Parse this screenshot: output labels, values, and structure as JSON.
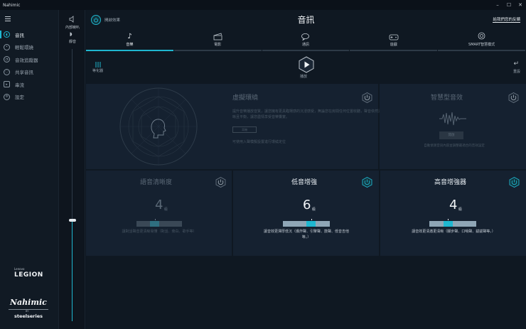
{
  "app": {
    "title": "Nahimic"
  },
  "window_controls": {
    "minimize": "–",
    "maximize": "☐",
    "close": "✕"
  },
  "sidebar": {
    "items": [
      {
        "label": "音訊",
        "icon": "audio-icon",
        "active": true
      },
      {
        "label": "輕鬆環繞",
        "icon": "surround-icon",
        "active": false
      },
      {
        "label": "音效追蹤器",
        "icon": "sound-tracker-icon",
        "active": false
      },
      {
        "label": "共享音訊",
        "icon": "share-audio-icon",
        "active": false
      },
      {
        "label": "串流",
        "icon": "stream-icon",
        "active": false
      },
      {
        "label": "設定",
        "icon": "gear-icon",
        "active": false
      }
    ],
    "brand_small": "Lenovo",
    "brand_legion": "LEGION",
    "brand_nahimic": "Nahimic",
    "brand_by": "BY",
    "brand_steelseries": "steelseries"
  },
  "volume": {
    "device_label": "內部喇叭",
    "mute_label": "靜音",
    "level": 0.37
  },
  "header": {
    "power_label": "開啟效果",
    "title": "音訊",
    "feedback": "給我們您的反饋"
  },
  "tabs": [
    {
      "label": "音樂",
      "icon": "music-icon",
      "active": true
    },
    {
      "label": "電影",
      "icon": "movie-icon",
      "active": false
    },
    {
      "label": "通訊",
      "icon": "chat-icon",
      "active": false
    },
    {
      "label": "遊戲",
      "icon": "gamepad-icon",
      "active": false
    },
    {
      "label": "SMART智慧模式",
      "icon": "smart-icon",
      "active": false
    }
  ],
  "toolbar": {
    "eq_label": "等化器",
    "play_label": "播放",
    "reset_label": "重設"
  },
  "virtual_surround": {
    "title": "虛擬環繞",
    "desc": "提升音樂播放音質，讓您擁有更具臨場感的沉浸感受，無論您在房間任何位置收聽，聲音依然清晰且平衡，讓您盡情享受音樂饗宴。",
    "tag": "耳機",
    "foot": "可使用入聲模擬設置進行環繞定位"
  },
  "smart_effect": {
    "title": "智慧型音效",
    "button": "開啟",
    "desc": "自動偵測音訊內容並調整最適合的音效設定"
  },
  "clarity": {
    "title": "語音清晰度",
    "level": 4,
    "unit": "級",
    "desc": "讓對話聲音更清晰易懂（對話、旁白、歌手等）"
  },
  "bass": {
    "title": "低音增強",
    "level": 6,
    "unit": "級",
    "desc": "讓音效更渾厚低沉（爆炸聲、引擎聲、鼓聲、低音吉他等。）"
  },
  "treble": {
    "title": "高音增強器",
    "level": 4,
    "unit": "級",
    "desc": "讓音效更清澈更清晰（腳步聲、口哨聲、鈸鈸聲等。）"
  },
  "colors": {
    "accent": "#1fb7d0",
    "panel": "#152130",
    "bg": "#0f1822"
  }
}
